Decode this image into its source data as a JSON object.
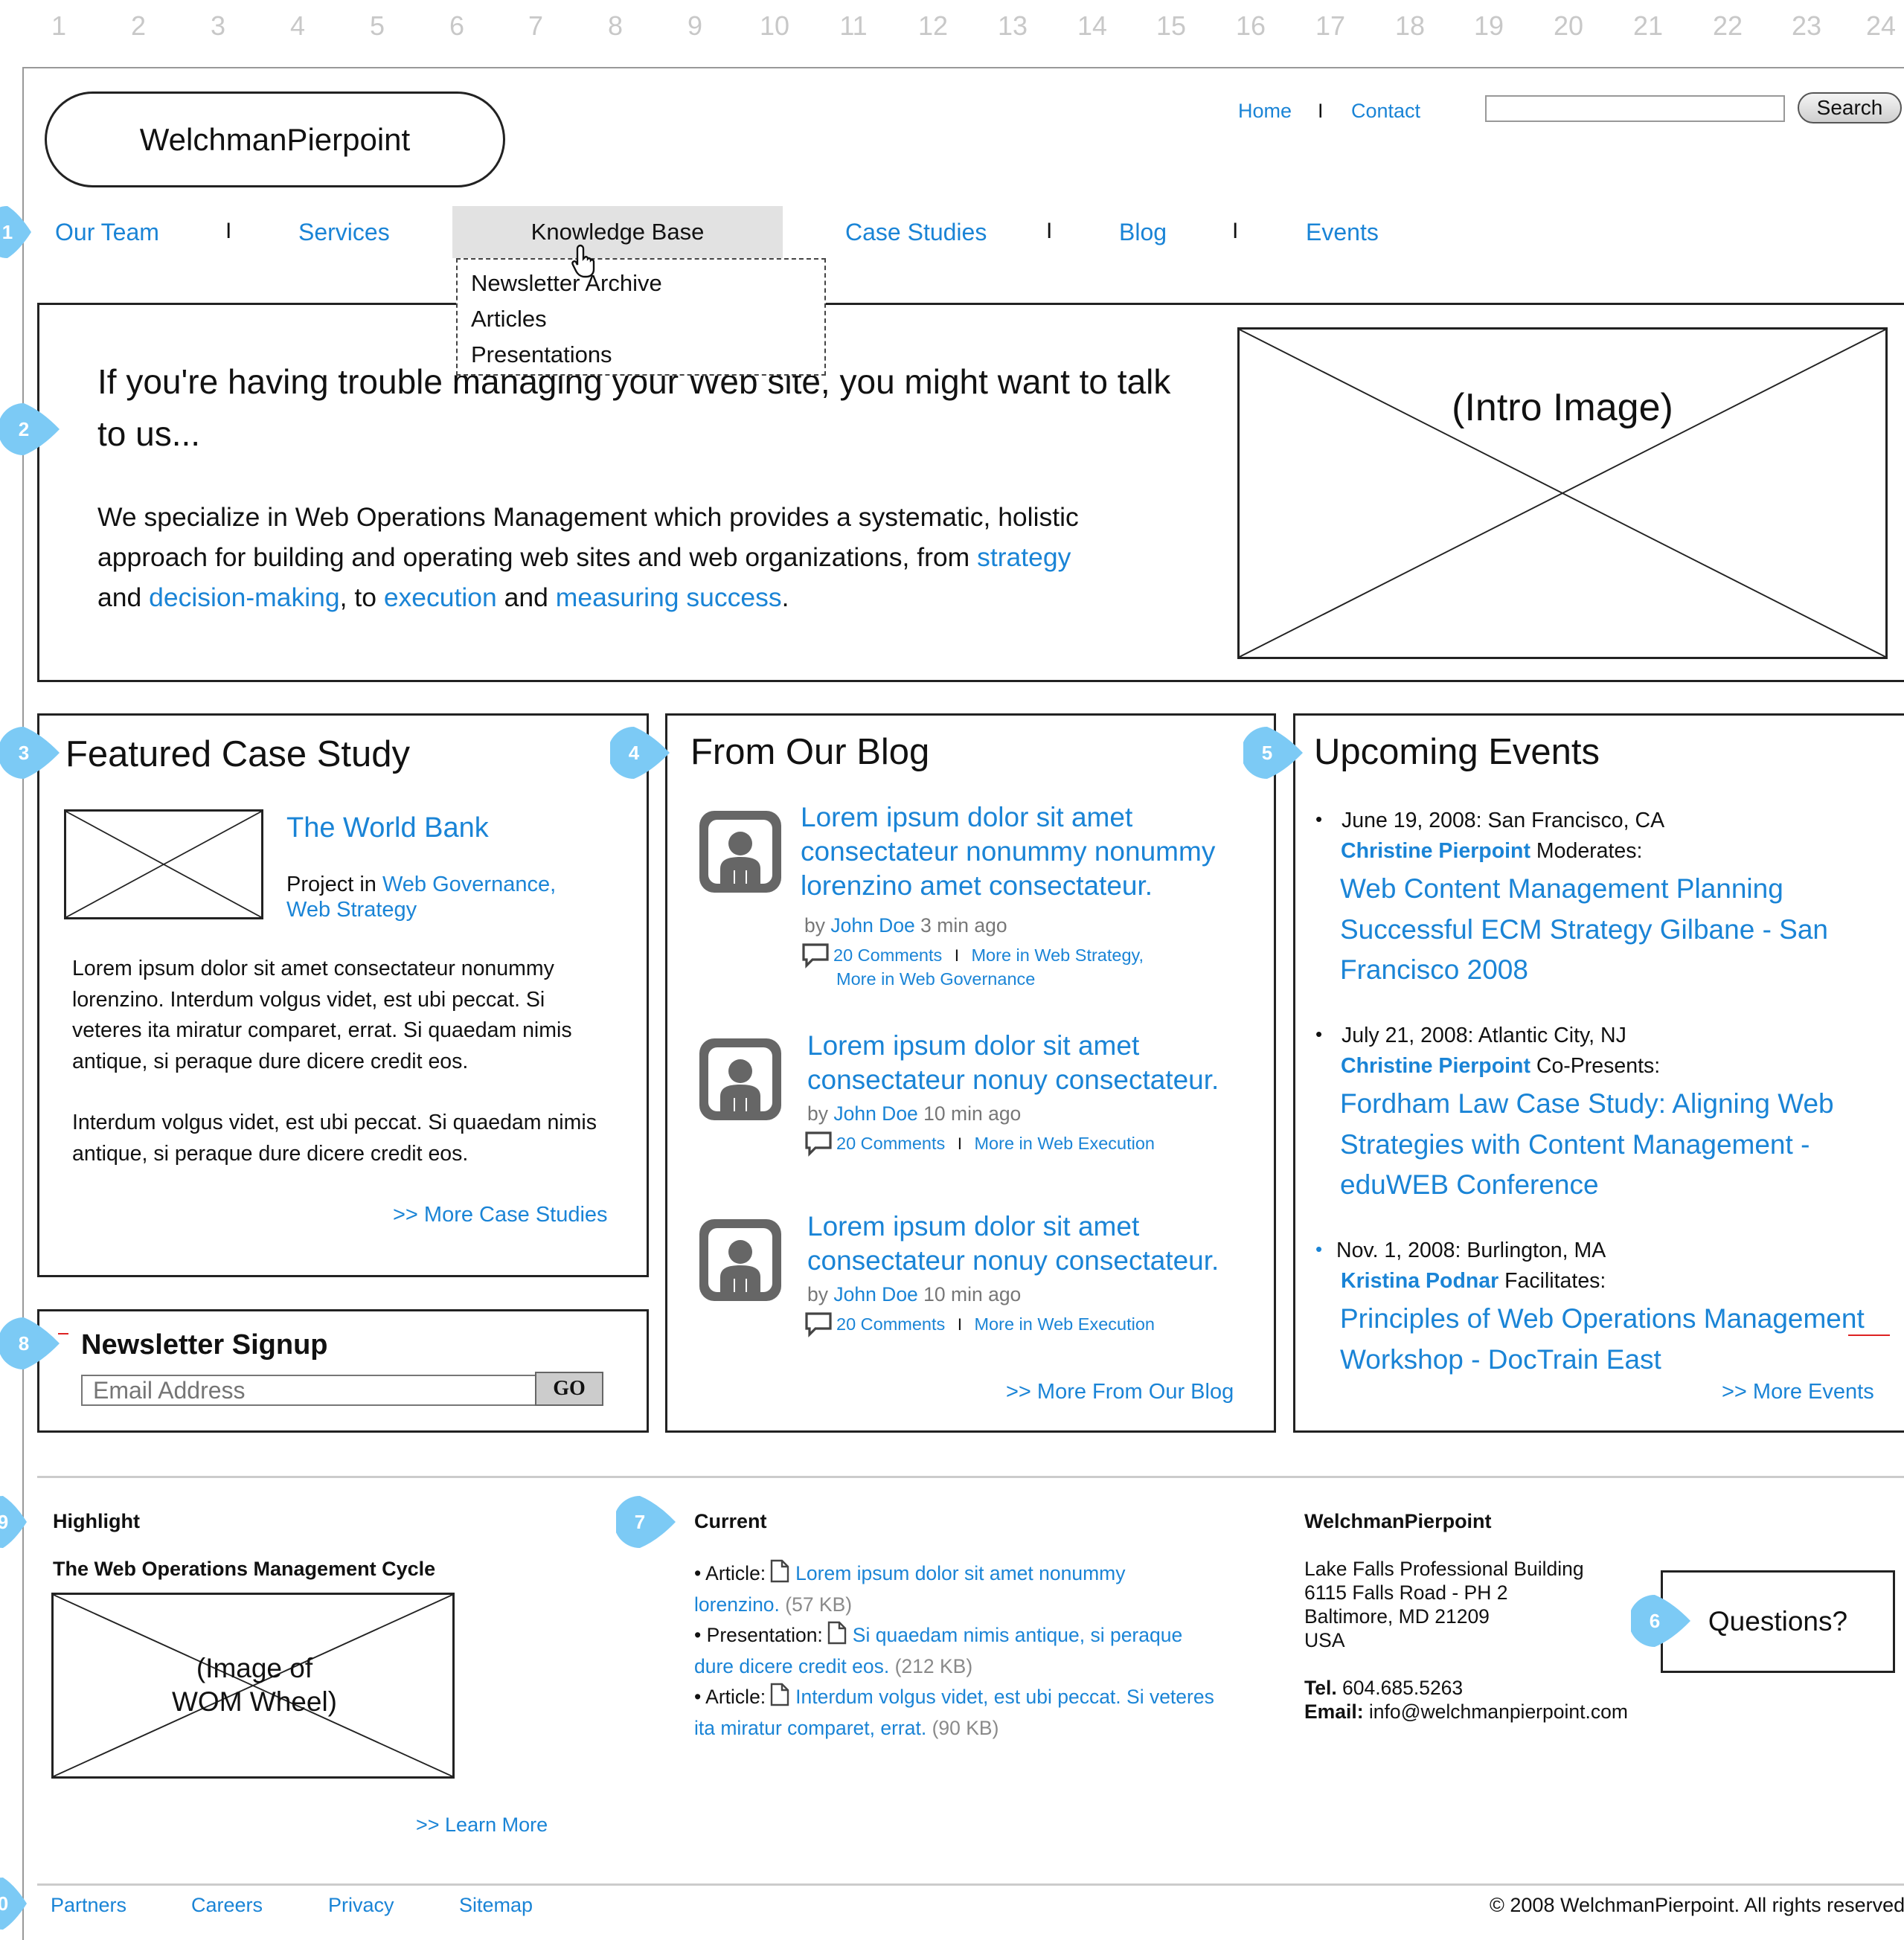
{
  "ruler": [
    "1",
    "2",
    "3",
    "4",
    "5",
    "6",
    "7",
    "8",
    "9",
    "10",
    "11",
    "12",
    "13",
    "14",
    "15",
    "16",
    "17",
    "18",
    "19",
    "20",
    "21",
    "22",
    "23",
    "24"
  ],
  "callouts": {
    "c1": "1",
    "c2": "2",
    "c3": "3",
    "c4": "4",
    "c5": "5",
    "c6": "6",
    "c7": "7",
    "c8": "8",
    "c9": "9",
    "c10": "0"
  },
  "header": {
    "logo": "WelchmanPierpoint",
    "links": {
      "home": "Home",
      "sep": "I",
      "contact": "Contact"
    },
    "search_button": "Search"
  },
  "nav": {
    "our_team": "Our Team",
    "services": "Services",
    "knowledge_base": "Knowledge Base",
    "case_studies": "Case Studies",
    "blog": "Blog",
    "events": "Events",
    "sep": "I",
    "dropdown": [
      "Newsletter Archive",
      "Articles",
      "Presentations"
    ]
  },
  "intro": {
    "headline": "If you're having trouble managing your Web site, you might want to talk to us...",
    "body_1": "We specialize in Web Operations Management which provides a systematic, holistic approach for building and operating web sites and web organizations, from ",
    "link_strategy": "strategy",
    "body_2": "and ",
    "link_decision": "decision-making",
    "body_3": ", to ",
    "link_execution": "execution",
    "body_4": " and ",
    "link_measuring": "measuring success",
    "body_5": ".",
    "image_label": "(Intro Image)"
  },
  "case_study": {
    "heading": "Featured Case Study",
    "title": "The World Bank",
    "project_prefix": "Project in ",
    "project_link_1": "Web Governance,",
    "project_link_2": "Web Strategy",
    "para_1": "Lorem ipsum dolor sit amet consectateur nonummy lorenzino. Interdum volgus videt, est ubi peccat. Si veteres ita miratur comparet, errat. Si quaedam nimis antique, si peraque dure dicere credit eos.",
    "para_2": "Interdum volgus videt, est ubi peccat.  Si quaedam nimis antique, si peraque dure dicere credit eos.",
    "more": ">> More Case Studies"
  },
  "newsletter": {
    "heading": "Newsletter Signup",
    "placeholder": "Email Address",
    "go": "GO"
  },
  "blog": {
    "heading": "From Our Blog",
    "by": "by ",
    "sep": "I",
    "posts": [
      {
        "title": "Lorem ipsum dolor sit amet consectateur nonummy nonummy lorenzino amet consectateur.",
        "author": "John Doe",
        "time": " 3 min ago",
        "comments": "20 Comments",
        "more": "More in Web Strategy,",
        "more2": "More in Web Governance"
      },
      {
        "title": "Lorem ipsum dolor sit amet consectateur nonuy consectateur.",
        "author": "John Doe",
        "time": " 10 min ago",
        "comments": "20 Comments",
        "more": "More in Web Execution"
      },
      {
        "title": "Lorem ipsum dolor sit amet consectateur nonuy consectateur.",
        "author": "John Doe",
        "time": " 10 min ago",
        "comments": "20 Comments",
        "more": "More in Web Execution"
      }
    ],
    "more": ">> More From Our Blog"
  },
  "events": {
    "heading": "Upcoming Events",
    "items": [
      {
        "bullet": "•",
        "date": "June 19, 2008: San Francisco, CA",
        "person": "Christine Pierpoint",
        "role": " Moderates:",
        "title": "Web Content Management Planning Successful ECM Strategy Gilbane - San Francisco 2008"
      },
      {
        "bullet": "•",
        "date": "July 21, 2008: Atlantic City, NJ",
        "person": "Christine Pierpoint",
        "role": " Co-Presents:",
        "title": "Fordham Law Case Study: Aligning Web Strategies with Content Management - eduWEB Conference"
      },
      {
        "bullet": "•",
        "date": "Nov. 1, 2008: Burlington, MA",
        "person": "Kristina Podnar",
        "role": " Facilitates:",
        "title": "Principles of Web Operations Management Workshop - DocTrain East"
      }
    ],
    "more": ">> More Events"
  },
  "highlight": {
    "heading": "Highlight",
    "subheading": "The Web Operations Management Cycle",
    "image_label": "(Image of WOM Wheel)",
    "more": ">> Learn More"
  },
  "current": {
    "heading": "Current",
    "items": [
      {
        "type": "• Article:",
        "link": "Lorem ipsum dolor sit amet nonummy lorenzino.",
        "size": " (57 KB)"
      },
      {
        "type": "• Presentation:",
        "link": "Si quaedam nimis antique, si peraque dure dicere credit eos.",
        "size": " (212 KB)"
      },
      {
        "type": "• Article:",
        "link": "Interdum volgus videt, est ubi peccat. Si veteres ita miratur comparet, errat.",
        "size": " (90 KB)"
      }
    ]
  },
  "contact": {
    "heading": "WelchmanPierpoint",
    "line1": "Lake Falls Professional Building",
    "line2": "6115 Falls Road - PH 2",
    "line3": "Baltimore, MD 21209",
    "line4": "USA",
    "tel_label": "Tel.",
    "tel": " 604.685.5263",
    "email_label": "Email:",
    "email": " info@welchmanpierpoint.com",
    "questions": "Questions?"
  },
  "footer": {
    "links": [
      "Partners",
      "Careers",
      "Privacy",
      "Sitemap"
    ],
    "copyright": "© 2008 WelchmanPierpoint.  All rights reserved"
  },
  "colors": {
    "link": "#1a84d6",
    "callout": "#7ccaf5",
    "grid": "#c8c8c8"
  }
}
